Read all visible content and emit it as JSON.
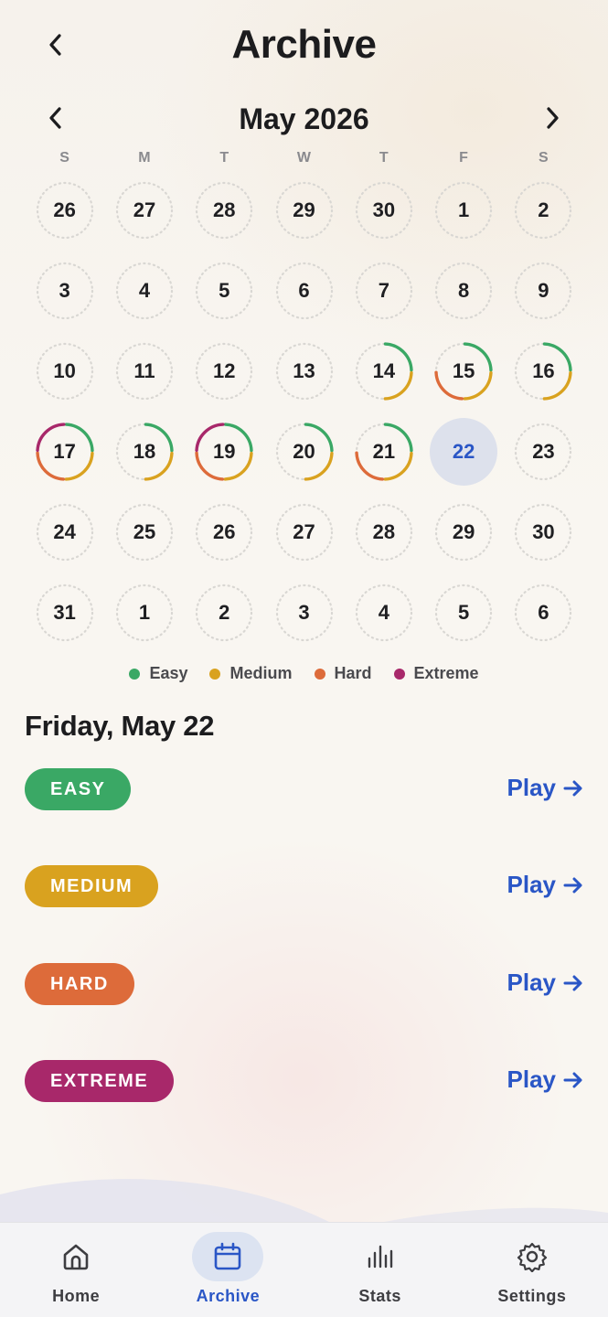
{
  "header": {
    "title": "Archive"
  },
  "month": {
    "label": "May 2026"
  },
  "weekdays": [
    "S",
    "M",
    "T",
    "W",
    "T",
    "F",
    "S"
  ],
  "colors": {
    "easy": "#3aa865",
    "medium": "#d9a21f",
    "hard": "#dd6b3a",
    "extreme": "#a8286a",
    "accent": "#2a56c6"
  },
  "days": [
    {
      "label": "26",
      "progress": []
    },
    {
      "label": "27",
      "progress": []
    },
    {
      "label": "28",
      "progress": []
    },
    {
      "label": "29",
      "progress": []
    },
    {
      "label": "30",
      "progress": []
    },
    {
      "label": "1",
      "progress": []
    },
    {
      "label": "2",
      "progress": []
    },
    {
      "label": "3",
      "progress": []
    },
    {
      "label": "4",
      "progress": []
    },
    {
      "label": "5",
      "progress": []
    },
    {
      "label": "6",
      "progress": []
    },
    {
      "label": "7",
      "progress": []
    },
    {
      "label": "8",
      "progress": []
    },
    {
      "label": "9",
      "progress": []
    },
    {
      "label": "10",
      "progress": []
    },
    {
      "label": "11",
      "progress": []
    },
    {
      "label": "12",
      "progress": []
    },
    {
      "label": "13",
      "progress": []
    },
    {
      "label": "14",
      "progress": [
        "easy",
        "medium"
      ]
    },
    {
      "label": "15",
      "progress": [
        "easy",
        "medium",
        "hard"
      ]
    },
    {
      "label": "16",
      "progress": [
        "easy",
        "medium"
      ]
    },
    {
      "label": "17",
      "progress": [
        "easy",
        "medium",
        "hard",
        "extreme"
      ]
    },
    {
      "label": "18",
      "progress": [
        "easy",
        "medium"
      ]
    },
    {
      "label": "19",
      "progress": [
        "easy",
        "medium",
        "hard",
        "extreme"
      ]
    },
    {
      "label": "20",
      "progress": [
        "easy",
        "medium"
      ]
    },
    {
      "label": "21",
      "progress": [
        "easy",
        "medium",
        "hard"
      ]
    },
    {
      "label": "22",
      "progress": [],
      "selected": true
    },
    {
      "label": "23",
      "progress": []
    },
    {
      "label": "24",
      "progress": []
    },
    {
      "label": "25",
      "progress": []
    },
    {
      "label": "26",
      "progress": []
    },
    {
      "label": "27",
      "progress": []
    },
    {
      "label": "28",
      "progress": []
    },
    {
      "label": "29",
      "progress": []
    },
    {
      "label": "30",
      "progress": []
    },
    {
      "label": "31",
      "progress": []
    },
    {
      "label": "1",
      "progress": []
    },
    {
      "label": "2",
      "progress": []
    },
    {
      "label": "3",
      "progress": []
    },
    {
      "label": "4",
      "progress": []
    },
    {
      "label": "5",
      "progress": []
    },
    {
      "label": "6",
      "progress": []
    }
  ],
  "legend": [
    {
      "label": "Easy",
      "key": "easy"
    },
    {
      "label": "Medium",
      "key": "medium"
    },
    {
      "label": "Hard",
      "key": "hard"
    },
    {
      "label": "Extreme",
      "key": "extreme"
    }
  ],
  "selected_day": {
    "heading": "Friday, May 22",
    "puzzles": [
      {
        "level": "EASY",
        "key": "easy",
        "action": "Play"
      },
      {
        "level": "MEDIUM",
        "key": "medium",
        "action": "Play"
      },
      {
        "level": "HARD",
        "key": "hard",
        "action": "Play"
      },
      {
        "level": "EXTREME",
        "key": "extreme",
        "action": "Play"
      }
    ]
  },
  "tabs": [
    {
      "label": "Home",
      "icon": "home-icon",
      "active": false
    },
    {
      "label": "Archive",
      "icon": "calendar-icon",
      "active": true
    },
    {
      "label": "Stats",
      "icon": "stats-icon",
      "active": false
    },
    {
      "label": "Settings",
      "icon": "gear-icon",
      "active": false
    }
  ]
}
